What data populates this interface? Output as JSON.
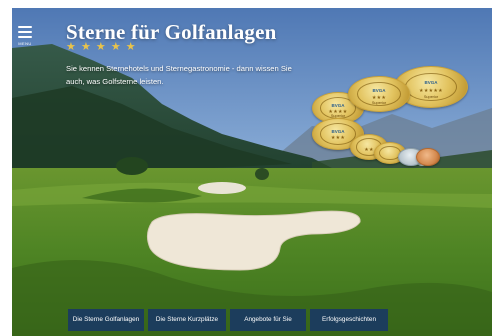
{
  "menu": {
    "label": "MENU",
    "icon": "hamburger-icon"
  },
  "hero": {
    "title": "Sterne für Golfanlagen",
    "stars": [
      "★",
      "★",
      "★",
      "★",
      "★"
    ],
    "star_color": "#e9c34a",
    "intro": "Sie kennen Sternehotels und Sternegastronomie - dann wissen Sie auch, was Golfsterne leisten."
  },
  "medals": [
    {
      "logo": "BVGA",
      "stars": "★★★★★",
      "grade": "Superior"
    },
    {
      "logo": "BVGA",
      "stars": "★★★★",
      "grade": "Superior"
    },
    {
      "logo": "BVGA",
      "stars": "★★★",
      "grade": "Superior"
    },
    {
      "logo": "BVGA",
      "stars": "★★★",
      "grade": ""
    },
    {
      "logo": "",
      "stars": "★★",
      "grade": ""
    },
    {
      "logo": "",
      "stars": "",
      "grade": ""
    }
  ],
  "nav": [
    {
      "label": "Die Sterne Golfanlagen"
    },
    {
      "label": "Die Sterne Kurzplätze"
    },
    {
      "label": "Angebote für Sie"
    },
    {
      "label": "Erfolgsgeschichten"
    }
  ],
  "colors": {
    "nav_bg": "#1a3a62",
    "medal_gold": "#e2c35f"
  }
}
